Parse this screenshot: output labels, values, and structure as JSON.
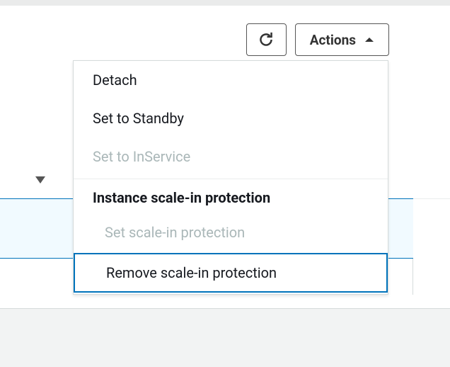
{
  "toolbar": {
    "actions_label": "Actions"
  },
  "menu": {
    "detach": "Detach",
    "standby": "Set to Standby",
    "inservice": "Set to InService",
    "section_header": "Instance scale-in protection",
    "set_protection": "Set scale-in protection",
    "remove_protection": "Remove scale-in protection"
  }
}
